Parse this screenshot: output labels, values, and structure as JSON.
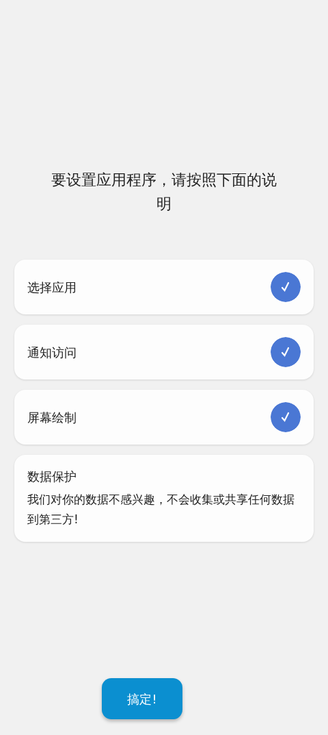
{
  "heading": "要设置应用程序，请按照下面的说明",
  "steps": [
    {
      "label": "选择应用",
      "checked": true
    },
    {
      "label": "通知访问",
      "checked": true
    },
    {
      "label": "屏幕绘制",
      "checked": true
    }
  ],
  "notice": {
    "title": "数据保护",
    "body": "我们对你的数据不感兴趣，不会收集或共享任何数据到第三方!"
  },
  "done_button": "搞定!"
}
